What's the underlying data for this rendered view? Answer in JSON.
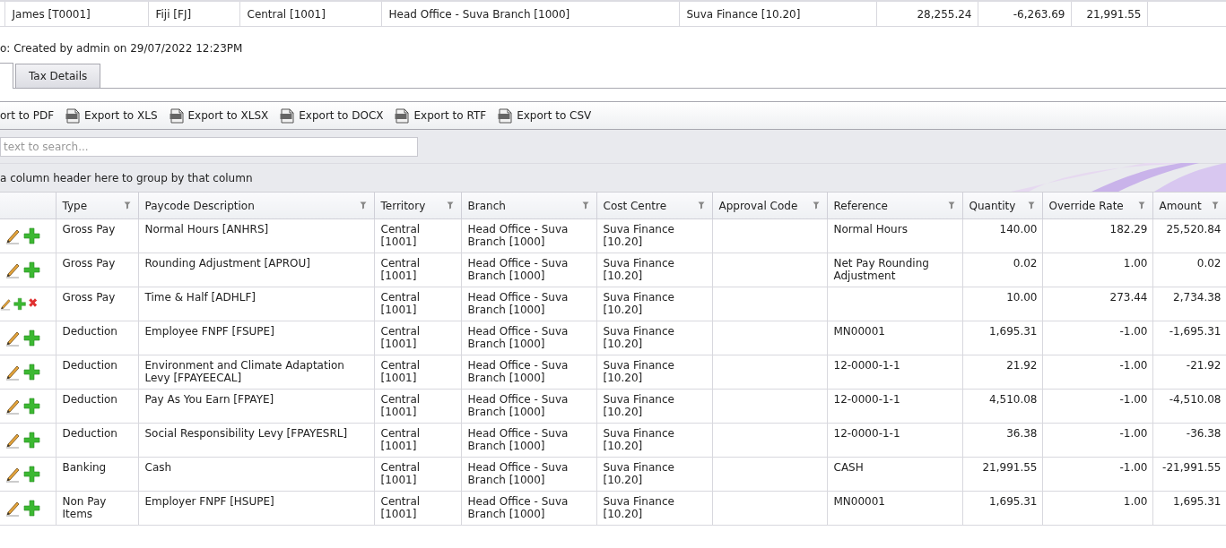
{
  "summary_row": {
    "cells": [
      "James [T0001]",
      "Fiji [FJ]",
      "Central [1001]",
      "Head Office - Suva Branch [1000]",
      "Suva Finance [10.20]",
      "28,255.24",
      "-6,263.69",
      "21,991.55"
    ]
  },
  "info_line": "o: Created by admin on 29/07/2022 12:23PM",
  "tabs": [
    {
      "selected": true
    },
    {
      "label": "Tax Details",
      "selected": false
    }
  ],
  "export_toolbar": [
    {
      "label": "ort to PDF",
      "icon": false
    },
    {
      "label": "Export to XLS",
      "icon": true
    },
    {
      "label": "Export to XLSX",
      "icon": true
    },
    {
      "label": "Export to DOCX",
      "icon": true
    },
    {
      "label": "Export to RTF",
      "icon": true
    },
    {
      "label": "Export to CSV",
      "icon": true
    }
  ],
  "search": {
    "placeholder": "text to search..."
  },
  "group_panel": "a column header here to group by that column",
  "table": {
    "columns": [
      "Type",
      "Paycode Description",
      "Territory",
      "Branch",
      "Cost Centre",
      "Approval Code",
      "Reference",
      "Quantity",
      "Override Rate",
      "Amount"
    ],
    "rows": [
      {
        "deletable": false,
        "cells": [
          "Gross Pay",
          "Normal Hours [ANHRS]",
          "Central [1001]",
          "Head Office - Suva Branch [1000]",
          "Suva Finance [10.20]",
          "",
          "Normal Hours",
          "140.00",
          "182.29",
          "25,520.84"
        ]
      },
      {
        "deletable": false,
        "cells": [
          "Gross Pay",
          "Rounding Adjustment [APROU]",
          "Central [1001]",
          "Head Office - Suva Branch [1000]",
          "Suva Finance [10.20]",
          "",
          "Net Pay Rounding Adjustment",
          "0.02",
          "1.00",
          "0.02"
        ]
      },
      {
        "deletable": true,
        "cells": [
          "Gross Pay",
          "Time & Half [ADHLF]",
          "Central [1001]",
          "Head Office - Suva Branch [1000]",
          "Suva Finance [10.20]",
          "",
          "",
          "10.00",
          "273.44",
          "2,734.38"
        ]
      },
      {
        "deletable": false,
        "cells": [
          "Deduction",
          "Employee FNPF [FSUPE]",
          "Central [1001]",
          "Head Office - Suva Branch [1000]",
          "Suva Finance [10.20]",
          "",
          "MN00001",
          "1,695.31",
          "-1.00",
          "-1,695.31"
        ]
      },
      {
        "deletable": false,
        "cells": [
          "Deduction",
          "Environment and Climate Adaptation Levy [FPAYEECAL]",
          "Central [1001]",
          "Head Office - Suva Branch [1000]",
          "Suva Finance [10.20]",
          "",
          "12-0000-1-1",
          "21.92",
          "-1.00",
          "-21.92"
        ]
      },
      {
        "deletable": false,
        "cells": [
          "Deduction",
          "Pay As You Earn [FPAYE]",
          "Central [1001]",
          "Head Office - Suva Branch [1000]",
          "Suva Finance [10.20]",
          "",
          "12-0000-1-1",
          "4,510.08",
          "-1.00",
          "-4,510.08"
        ]
      },
      {
        "deletable": false,
        "cells": [
          "Deduction",
          "Social Responsibility Levy [FPAYESRL]",
          "Central [1001]",
          "Head Office - Suva Branch [1000]",
          "Suva Finance [10.20]",
          "",
          "12-0000-1-1",
          "36.38",
          "-1.00",
          "-36.38"
        ]
      },
      {
        "deletable": false,
        "cells": [
          "Banking",
          "Cash",
          "Central [1001]",
          "Head Office - Suva Branch [1000]",
          "Suva Finance [10.20]",
          "",
          "CASH",
          "21,991.55",
          "-1.00",
          "-21,991.55"
        ]
      },
      {
        "deletable": false,
        "cells": [
          "Non Pay Items",
          "Employer FNPF [HSUPE]",
          "Central [1001]",
          "Head Office - Suva Branch [1000]",
          "Suva Finance [10.20]",
          "",
          "MN00001",
          "1,695.31",
          "1.00",
          "1,695.31"
        ]
      }
    ]
  }
}
